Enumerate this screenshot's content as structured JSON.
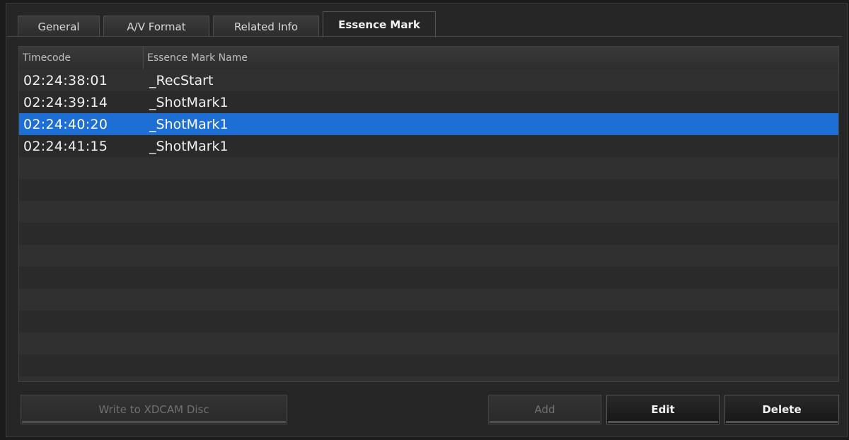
{
  "tabs": [
    {
      "label": "General",
      "active": false
    },
    {
      "label": "A/V Format",
      "active": false
    },
    {
      "label": "Related Info",
      "active": false
    },
    {
      "label": "Essence Mark",
      "active": true
    }
  ],
  "table": {
    "headers": {
      "timecode": "Timecode",
      "name": "Essence Mark Name"
    },
    "rows": [
      {
        "timecode": "02:24:38:01",
        "name": "_RecStart"
      },
      {
        "timecode": "02:24:39:14",
        "name": "_ShotMark1"
      },
      {
        "timecode": "02:24:40:20",
        "name": "_ShotMark1"
      },
      {
        "timecode": "02:24:41:15",
        "name": "_ShotMark1"
      }
    ],
    "selected_row_index": 2
  },
  "buttons": {
    "write_disc": "Write to XDCAM Disc",
    "add": "Add",
    "edit": "Edit",
    "delete": "Delete"
  },
  "colors": {
    "selection": "#1d6fd6",
    "background": "#262626"
  }
}
